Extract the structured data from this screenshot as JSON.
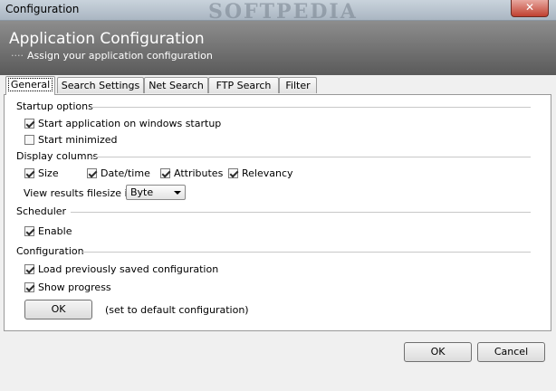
{
  "window": {
    "title": "Configuration",
    "close_label": "✕",
    "watermark": "SOFTPEDIA"
  },
  "banner": {
    "title": "Application Configuration",
    "subtitle": "Assign your application configuration",
    "subtitle_prefix": "····"
  },
  "tabs": [
    {
      "label": "General",
      "active": true
    },
    {
      "label": "Search Settings",
      "active": false
    },
    {
      "label": "Net Search",
      "active": false
    },
    {
      "label": "FTP Search",
      "active": false
    },
    {
      "label": "Filter",
      "active": false
    }
  ],
  "startup": {
    "heading": "Startup options",
    "start_on_boot": {
      "label": "Start application on windows startup",
      "checked": true
    },
    "start_minimized": {
      "label": "Start minimized",
      "checked": false
    }
  },
  "display": {
    "heading": "Display columns",
    "size": {
      "label": "Size",
      "checked": true
    },
    "datetime": {
      "label": "Date/time",
      "checked": true
    },
    "attributes": {
      "label": "Attributes",
      "checked": true
    },
    "relevancy": {
      "label": "Relevancy",
      "checked": true
    },
    "filesize_label": "View results filesize in",
    "filesize_value": "Byte"
  },
  "scheduler": {
    "heading": "Scheduler",
    "enable": {
      "label": "Enable",
      "checked": true
    }
  },
  "configuration": {
    "heading": "Configuration",
    "load_saved": {
      "label": "Load previously saved configuration",
      "checked": true
    },
    "show_progress": {
      "label": "Show progress",
      "checked": true
    },
    "ok_label": "OK",
    "default_note": "(set to default configuration)"
  },
  "footer": {
    "ok_label": "OK",
    "cancel_label": "Cancel"
  }
}
